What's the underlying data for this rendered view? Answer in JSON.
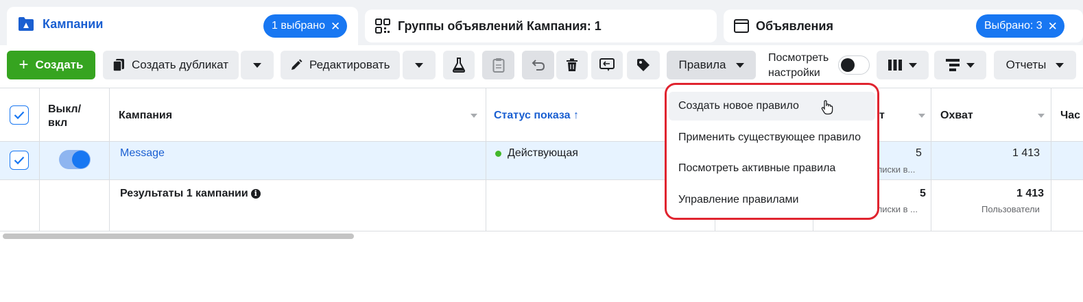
{
  "tabs": {
    "campaigns": {
      "title": "Кампании",
      "pill": "1 выбрано"
    },
    "adsets": {
      "title": "Группы объявлений Кампания: 1"
    },
    "ads": {
      "title": "Объявления",
      "pill": "Выбрано: 3"
    }
  },
  "toolbar": {
    "create": "Создать",
    "duplicate": "Создать дубликат",
    "edit": "Редактировать",
    "rules": "Правила",
    "view_settings_line1": "Посмотреть",
    "view_settings_line2": "настройки",
    "reports": "Отчеты"
  },
  "rules_menu": {
    "items": [
      "Создать новое правило",
      "Применить существующее правило",
      "Посмотреть активные правила",
      "Управление правилами"
    ]
  },
  "table": {
    "headers": {
      "onoff_line1": "Выкл/",
      "onoff_line2": "вкл",
      "campaign": "Кампания",
      "status": "Статус показа ↑",
      "results_partial": "т",
      "reach": "Охват",
      "frequency_partial": "Час"
    },
    "row": {
      "name": "Message",
      "status": "Действующая",
      "results_value": "5",
      "results_sub": "еписки в...",
      "reach_value": "1 413"
    },
    "summary": {
      "label": "Результаты 1 кампании",
      "results_value": "5",
      "results_sub": "еписки в ...",
      "reach_value": "1 413",
      "reach_sub": "Пользователи"
    }
  },
  "colors": {
    "accent": "#1877f2",
    "create": "#36a420",
    "highlight": "#e0242f"
  }
}
